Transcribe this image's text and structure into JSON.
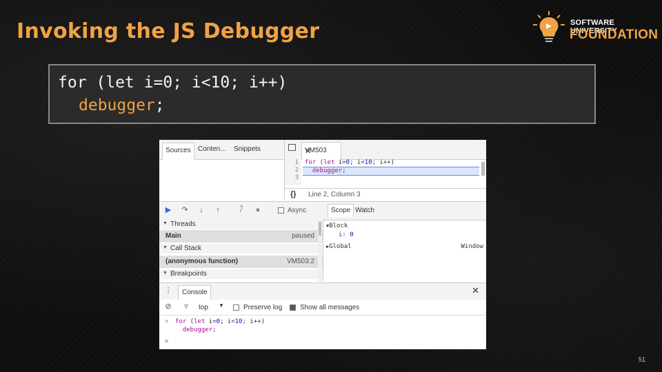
{
  "slide": {
    "title": "Invoking the JS Debugger",
    "page_number": "51"
  },
  "logo": {
    "line1": "SOFTWARE UNIVERSITY",
    "line2": "FOUNDATION",
    "icon": "lightbulb-icon"
  },
  "code": {
    "line1": "for (let i=0; i<10; i++)",
    "line2_keyword": "debugger",
    "line2_semi": ";"
  },
  "devtools": {
    "navigator_tabs": [
      "Sources",
      "Conten...",
      "Snippets"
    ],
    "file_tab": "VM503",
    "line_numbers": [
      "1",
      "2",
      "3"
    ],
    "code_line1": {
      "kw1": "for",
      "t1": " (",
      "kw2": "let",
      "t2": " i=",
      "n1": "0",
      "t3": "; i<",
      "n2": "10",
      "t4": "; i++)"
    },
    "code_line2": "  debugger;",
    "status_braces": "{}",
    "status_position": "Line 2, Column 3",
    "debug_toolbar": {
      "buttons": [
        "resume-icon",
        "step-over-icon",
        "step-into-icon",
        "step-out-icon",
        "deactivate-breakpoints-icon",
        "pause-exceptions-icon"
      ],
      "async_label": "Async",
      "async_checked": false
    },
    "threads": {
      "header": "Threads",
      "items": [
        {
          "name": "Main",
          "status": "paused"
        }
      ]
    },
    "call_stack": {
      "header": "Call Stack",
      "items": [
        {
          "name": "(anonymous function)",
          "location": "VM503:2"
        }
      ]
    },
    "breakpoints_header": "Breakpoints",
    "scope_tabs": [
      "Scope",
      "Watch"
    ],
    "scope": {
      "block_label": "Block",
      "var_name": "i",
      "var_value": "0",
      "global_label": "Global",
      "global_value": "Window"
    },
    "console": {
      "tab": "Console",
      "context": "top",
      "preserve_log_label": "Preserve log",
      "preserve_log_checked": false,
      "show_all_label": "Show all messages",
      "show_all_checked": true,
      "prompt_symbol": ">",
      "input_line1": {
        "kw1": "for",
        "t1": " (",
        "kw2": "let",
        "t2": " i=",
        "n1": "0",
        "t3": "; i<",
        "n2": "10",
        "t4": "; i++)"
      },
      "input_line2": "  debugger;",
      "next_prompt": ">"
    }
  },
  "colors": {
    "accent": "#f0a244",
    "background": "#0e0e0e",
    "code_box": "#2b2b2b"
  }
}
